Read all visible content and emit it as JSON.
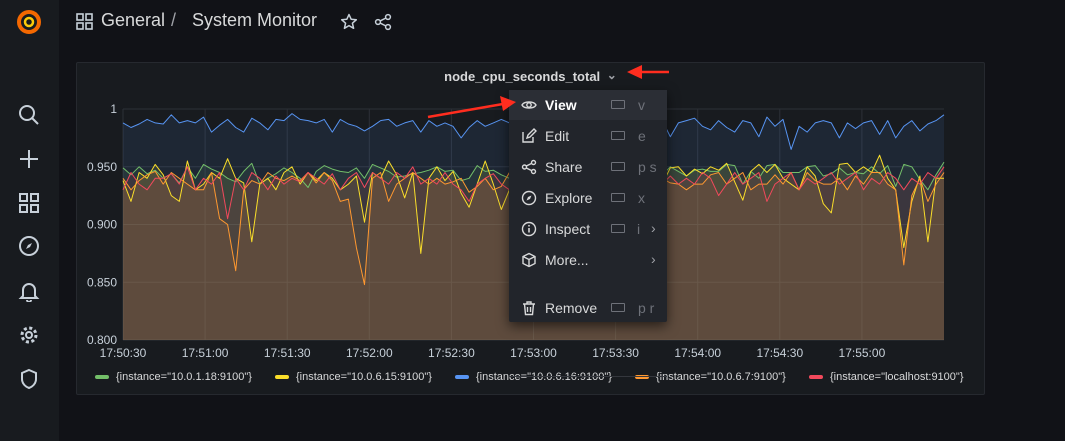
{
  "breadcrumb": {
    "folder": "General",
    "separator": "/",
    "dashboard": "System Monitor"
  },
  "topbar_icons": [
    "dashboards-grid-icon",
    "star-icon",
    "share-icon"
  ],
  "sidebar": {
    "icons": [
      "grafana-logo",
      "search-icon",
      "plus-icon",
      "dashboards-icon",
      "explore-compass-icon",
      "alerting-bell-icon",
      "configuration-gear-icon",
      "server-admin-shield-icon"
    ]
  },
  "panel": {
    "title": "node_cpu_seconds_total",
    "title_chevron": "⌄"
  },
  "menu": {
    "items": [
      {
        "label": "View",
        "key": "v",
        "icon": "eye-icon"
      },
      {
        "label": "Edit",
        "key": "e",
        "icon": "edit-icon"
      },
      {
        "label": "Share",
        "key": "p s",
        "icon": "share-icon"
      },
      {
        "label": "Explore",
        "key": "x",
        "icon": "compass-icon"
      },
      {
        "label": "Inspect",
        "key": "i",
        "icon": "info-circle-icon",
        "submenu": "›"
      },
      {
        "label": "More...",
        "key": "",
        "icon": "cube-icon",
        "submenu": "›"
      },
      {
        "label": "Remove",
        "key": "p r",
        "icon": "trash-icon"
      }
    ]
  },
  "annotation_color": "#ff2d1f",
  "chart_data": {
    "type": "area",
    "x": [
      "17:50:30",
      "17:51:00",
      "17:51:30",
      "17:52:00",
      "17:52:30",
      "17:53:00",
      "17:53:30",
      "17:54:00",
      "17:54:30",
      "17:55:00"
    ],
    "x_range": [
      "17:50:30",
      "17:55:30"
    ],
    "ylim": [
      0.8,
      1.0
    ],
    "yticks": [
      "0.800",
      "0.850",
      "0.900",
      "0.950",
      "1"
    ],
    "grid": true,
    "legend_position": "bottom",
    "series": [
      {
        "name": "{instance=\"10.0.1.18:9100\"}",
        "color": "#73bf69",
        "values": [
          0.949,
          0.943,
          0.95,
          0.944,
          0.947,
          0.94,
          0.944,
          0.936,
          0.95,
          0.94,
          0.952,
          0.948,
          0.945,
          0.94,
          0.937,
          0.946,
          0.953,
          0.935,
          0.94,
          0.944,
          0.949,
          0.945,
          0.94,
          0.932,
          0.946,
          0.951,
          0.948,
          0.946,
          0.945,
          0.949,
          0.94,
          0.952,
          0.949,
          0.946,
          0.941,
          0.942,
          0.944,
          0.945,
          0.947,
          0.95,
          0.946,
          0.947,
          0.938,
          0.94,
          0.951,
          0.946,
          0.947,
          0.943,
          0.94,
          0.947,
          0.954,
          0.953,
          0.95,
          0.945,
          0.949,
          0.944,
          0.951,
          0.941,
          0.93,
          0.946,
          0.941,
          0.946,
          0.951,
          0.94,
          0.934,
          0.946,
          0.948,
          0.943,
          0.95,
          0.946,
          0.942,
          0.947,
          0.948,
          0.946,
          0.946,
          0.952,
          0.951,
          0.935,
          0.946,
          0.94,
          0.951,
          0.952,
          0.945,
          0.945,
          0.945,
          0.95,
          0.951,
          0.942,
          0.944,
          0.949,
          0.943,
          0.945,
          0.944,
          0.95,
          0.944,
          0.951,
          0.933,
          0.952,
          0.95,
          0.939,
          0.93,
          0.943,
          0.954
        ]
      },
      {
        "name": "{instance=\"10.0.6.15:9100\"}",
        "color": "#fade2a",
        "values": [
          0.938,
          0.92,
          0.945,
          0.94,
          0.952,
          0.943,
          0.925,
          0.92,
          0.955,
          0.93,
          0.935,
          0.945,
          0.94,
          0.957,
          0.94,
          0.936,
          0.885,
          0.935,
          0.94,
          0.93,
          0.945,
          0.95,
          0.935,
          0.945,
          0.938,
          0.945,
          0.94,
          0.93,
          0.935,
          0.942,
          0.902,
          0.945,
          0.94,
          0.955,
          0.943,
          0.923,
          0.945,
          0.875,
          0.94,
          0.95,
          0.938,
          0.946,
          0.927,
          0.915,
          0.935,
          0.955,
          0.935,
          0.913,
          0.93,
          0.94,
          0.949,
          0.95,
          0.935,
          0.96,
          0.92,
          0.945,
          0.94,
          0.918,
          0.926,
          0.935,
          0.945,
          0.943,
          0.948,
          0.93,
          0.936,
          0.923,
          0.925,
          0.935,
          0.949,
          0.95,
          0.942,
          0.948,
          0.944,
          0.95,
          0.947,
          0.953,
          0.937,
          0.921,
          0.946,
          0.952,
          0.945,
          0.952,
          0.94,
          0.935,
          0.93,
          0.95,
          0.942,
          0.918,
          0.91,
          0.952,
          0.953,
          0.945,
          0.95,
          0.945,
          0.96,
          0.94,
          0.93,
          0.88,
          0.92,
          0.942,
          0.885,
          0.94,
          0.94
        ]
      },
      {
        "name": "{instance=\"10.0.6.16:9100\"}",
        "color": "#5794f2",
        "values": [
          0.988,
          0.984,
          0.987,
          0.991,
          0.988,
          0.987,
          0.995,
          0.988,
          0.99,
          0.988,
          0.993,
          0.98,
          0.986,
          0.991,
          0.984,
          0.98,
          0.992,
          0.988,
          0.982,
          0.991,
          0.99,
          0.996,
          0.991,
          0.99,
          0.988,
          0.991,
          0.98,
          0.991,
          0.987,
          0.985,
          0.981,
          0.985,
          0.99,
          0.991,
          0.985,
          0.988,
          0.99,
          0.98,
          0.99,
          0.985,
          0.988,
          0.985,
          0.975,
          0.984,
          0.99,
          0.985,
          0.988,
          0.991,
          0.988,
          0.984,
          0.987,
          0.992,
          0.978,
          0.99,
          0.98,
          0.988,
          0.988,
          0.981,
          0.99,
          0.99,
          0.988,
          0.991,
          0.985,
          0.993,
          0.988,
          0.99,
          0.985,
          0.99,
          0.976,
          0.988,
          0.99,
          0.992,
          0.985,
          0.982,
          0.99,
          0.984,
          0.98,
          0.99,
          0.988,
          0.976,
          0.993,
          0.985,
          0.991,
          0.965,
          0.985,
          0.98,
          0.988,
          0.99,
          0.988,
          0.975,
          0.988,
          0.983,
          0.988,
          0.99,
          0.978,
          0.99,
          0.975,
          0.985,
          0.99,
          0.981,
          0.987,
          0.99,
          0.995
        ]
      },
      {
        "name": "{instance=\"10.0.6.7:9100\"}",
        "color": "#ff9830",
        "values": [
          0.94,
          0.93,
          0.938,
          0.943,
          0.946,
          0.935,
          0.945,
          0.94,
          0.935,
          0.93,
          0.93,
          0.945,
          0.905,
          0.9,
          0.86,
          0.93,
          0.938,
          0.935,
          0.945,
          0.94,
          0.938,
          0.942,
          0.938,
          0.945,
          0.936,
          0.945,
          0.938,
          0.92,
          0.922,
          0.88,
          0.848,
          0.94,
          0.945,
          0.92,
          0.935,
          0.94,
          0.945,
          0.94,
          0.935,
          0.94,
          0.935,
          0.937,
          0.94,
          0.928,
          0.933,
          0.94,
          0.93,
          0.933,
          0.945,
          0.935,
          0.92,
          0.935,
          0.938,
          0.935,
          0.928,
          0.942,
          0.935,
          0.93,
          0.94,
          0.945,
          0.935,
          0.925,
          0.935,
          0.936,
          0.942,
          0.938,
          0.945,
          0.94,
          0.936,
          0.935,
          0.93,
          0.935,
          0.935,
          0.943,
          0.945,
          0.935,
          0.94,
          0.945,
          0.93,
          0.935,
          0.935,
          0.943,
          0.935,
          0.945,
          0.93,
          0.945,
          0.938,
          0.935,
          0.935,
          0.94,
          0.93,
          0.942,
          0.935,
          0.945,
          0.945,
          0.935,
          0.93,
          0.865,
          0.925,
          0.94,
          0.92,
          0.935,
          0.945
        ]
      },
      {
        "name": "{instance=\"localhost:9100\"}",
        "color": "#f2495c",
        "values": [
          0.93,
          0.945,
          0.935,
          0.93,
          0.94,
          0.94,
          0.944,
          0.935,
          0.95,
          0.93,
          0.94,
          0.935,
          0.945,
          0.905,
          0.94,
          0.93,
          0.945,
          0.94,
          0.93,
          0.942,
          0.935,
          0.94,
          0.937,
          0.945,
          0.94,
          0.935,
          0.944,
          0.93,
          0.94,
          0.945,
          0.932,
          0.945,
          0.94,
          0.935,
          0.945,
          0.94,
          0.95,
          0.935,
          0.94,
          0.935,
          0.945,
          0.935,
          0.93,
          0.92,
          0.935,
          0.94,
          0.944,
          0.935,
          0.93,
          0.94,
          0.935,
          0.935,
          0.942,
          0.938,
          0.945,
          0.94,
          0.945,
          0.935,
          0.94,
          0.935,
          0.945,
          0.94,
          0.94,
          0.935,
          0.94,
          0.93,
          0.945,
          0.935,
          0.942,
          0.935,
          0.94,
          0.935,
          0.945,
          0.94,
          0.925,
          0.935,
          0.945,
          0.935,
          0.94,
          0.945,
          0.92,
          0.935,
          0.94,
          0.945,
          0.93,
          0.94,
          0.935,
          0.94,
          0.945,
          0.935,
          0.94,
          0.945,
          0.93,
          0.94,
          0.935,
          0.945,
          0.94,
          0.93,
          0.94,
          0.935,
          0.945,
          0.94,
          0.95
        ]
      }
    ]
  }
}
